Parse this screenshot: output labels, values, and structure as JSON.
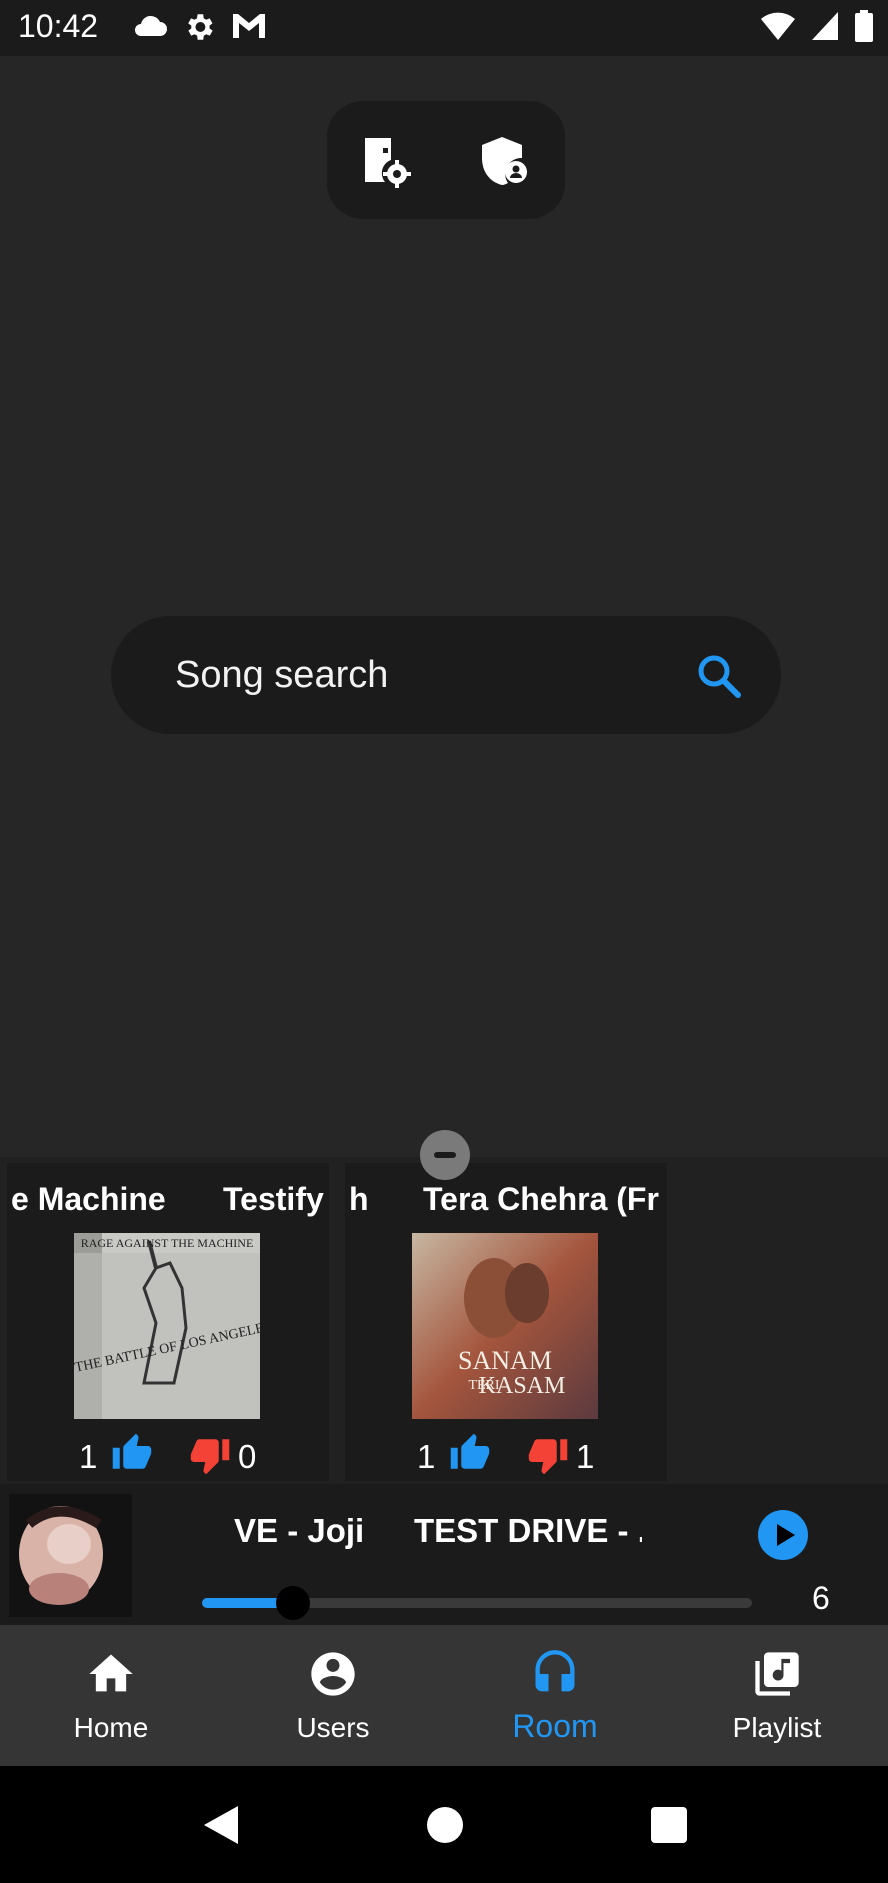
{
  "status_bar": {
    "time": "10:42",
    "left_icons": [
      "cloud-icon",
      "settings-icon",
      "gmail-icon"
    ],
    "right_icons": [
      "wifi-icon",
      "signal-icon",
      "battery-icon"
    ]
  },
  "room_controls": {
    "icons": [
      "room-settings-icon",
      "admin-shield-icon"
    ]
  },
  "search": {
    "placeholder": "Song search",
    "icon": "search-icon",
    "accent": "#2196f3"
  },
  "queue": [
    {
      "title_left": "e Machine",
      "title_right": "Testify",
      "likes": "1",
      "dislikes": "0",
      "cover": "rage-against-the-machine-battle-of-los-angeles-cover",
      "cover_text": [
        "RAGE AGAINST THE MACHINE",
        "THE BATTLE OF LOS ANGELES"
      ]
    },
    {
      "title_left": "h",
      "title_right": "Tera Chehra (Fr",
      "likes": "1",
      "dislikes": "1",
      "cover": "sanam-teri-kasam-cover",
      "cover_text": [
        "SANAM",
        "TERI",
        "KASAM"
      ]
    }
  ],
  "now_playing": {
    "title_left": "VE - Joji",
    "title_right": "TEST DRIVE - .",
    "time_remaining": "6",
    "progress": 0.165,
    "cover": "joji-cover"
  },
  "bottom_nav": {
    "items": [
      {
        "label": "Home",
        "icon": "home-icon",
        "active": false
      },
      {
        "label": "Users",
        "icon": "user-icon",
        "active": false
      },
      {
        "label": "Room",
        "icon": "headphones-icon",
        "active": true
      },
      {
        "label": "Playlist",
        "icon": "playlist-icon",
        "active": false
      }
    ]
  },
  "colors": {
    "like": "#2196f3",
    "dislike": "#f44336",
    "active_tab": "#2196f3"
  }
}
